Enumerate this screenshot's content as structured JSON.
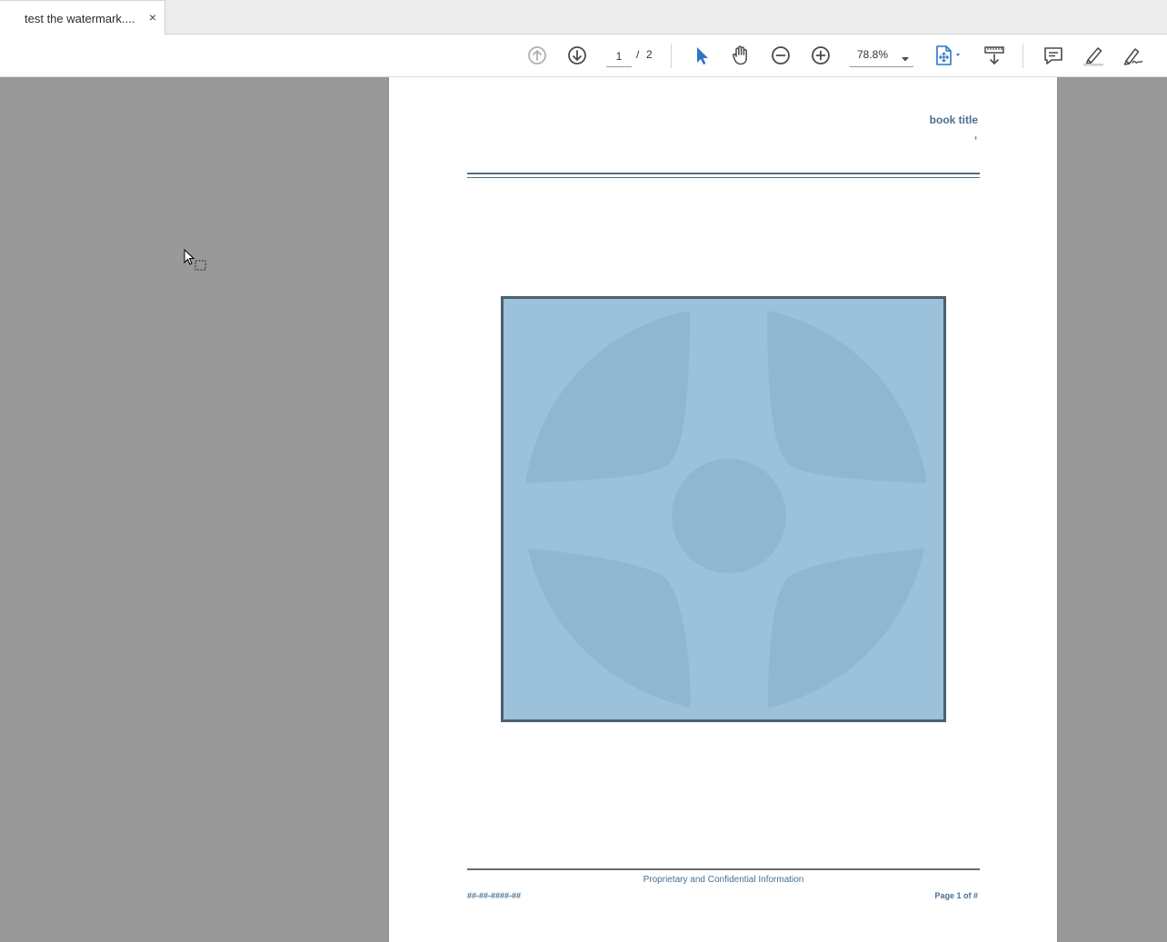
{
  "tab": {
    "title": "test the watermark....",
    "close_label": "×"
  },
  "toolbar": {
    "current_page": "1",
    "page_separator": "/",
    "total_pages": "2",
    "zoom": "78.8%",
    "icons": {
      "prev_page": "arrow-up-circle-icon",
      "next_page": "arrow-down-circle-icon",
      "select": "pointer-arrow-icon",
      "hand": "hand-pan-icon",
      "zoom_out": "zoom-out-icon",
      "zoom_in": "zoom-in-icon",
      "page_fit": "page-fit-icon",
      "scroll_mode": "scroll-mode-icon",
      "comment": "comment-icon",
      "highlight": "highlight-pen-icon",
      "sign": "sign-pen-icon"
    }
  },
  "document": {
    "header_title": "book title",
    "header_sub": ",",
    "footer_center": "Proprietary and Confidential Information",
    "footer_left": "##-##-####-##",
    "footer_right": "Page 1 of #"
  },
  "colors": {
    "accent": "#2f73c4",
    "viewer_bg": "#999999",
    "doc_text": "#4a6f8e",
    "image_bg": "#9bc1db",
    "image_shape": "#90b7d2"
  }
}
